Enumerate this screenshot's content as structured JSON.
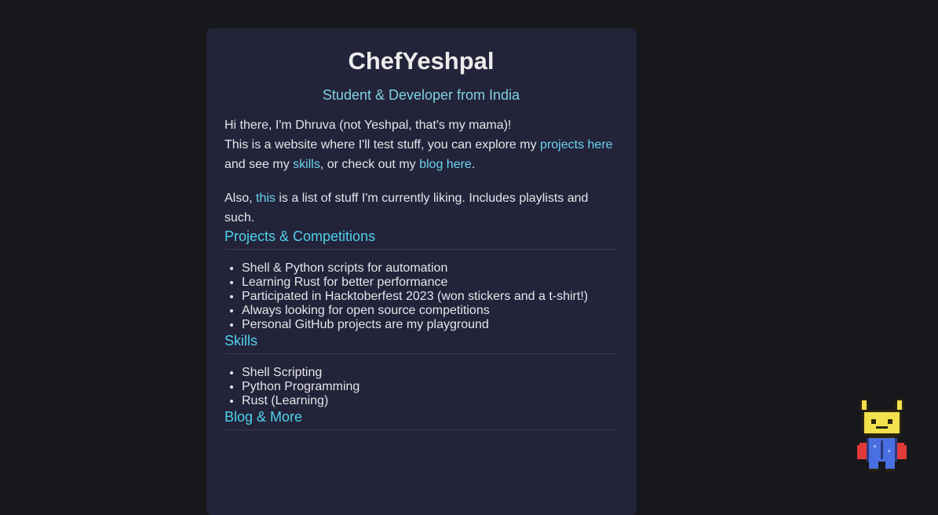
{
  "header": {
    "title": "ChefYeshpal",
    "subtitle": "Student & Developer from India"
  },
  "intro": {
    "line1": "Hi there, I'm Dhruva (not Yeshpal, that's my mama)!",
    "line2_prefix": "This is a website where I'll test stuff, you can explore my ",
    "projects_link": "projects here",
    "line3_prefix": "and see my ",
    "skills_link": "skills",
    "line3_middle": ", or check out my ",
    "blog_link": "blog here",
    "line3_suffix": ".",
    "also_prefix": "Also, ",
    "this_link": "this",
    "also_suffix": " is a list of stuff I'm currently liking. Includes playlists and such."
  },
  "projects": {
    "heading": "Projects & Competitions",
    "items": [
      "Shell & Python scripts for automation",
      "Learning Rust for better performance",
      "Participated in Hacktoberfest 2023 (won stickers and a t-shirt!)",
      "Always looking for open source competitions",
      "Personal GitHub projects are my playground"
    ]
  },
  "skills": {
    "heading": "Skills",
    "items": [
      "Shell Scripting",
      "Python Programming",
      "Rust (Learning)"
    ]
  },
  "blog": {
    "heading": "Blog & More"
  },
  "mascot": {
    "icon": "pixel-horned-mascot-icon",
    "colors": {
      "body": "#f4e04d",
      "cape": "#e03a3a",
      "suit": "#4a6fe0"
    }
  }
}
